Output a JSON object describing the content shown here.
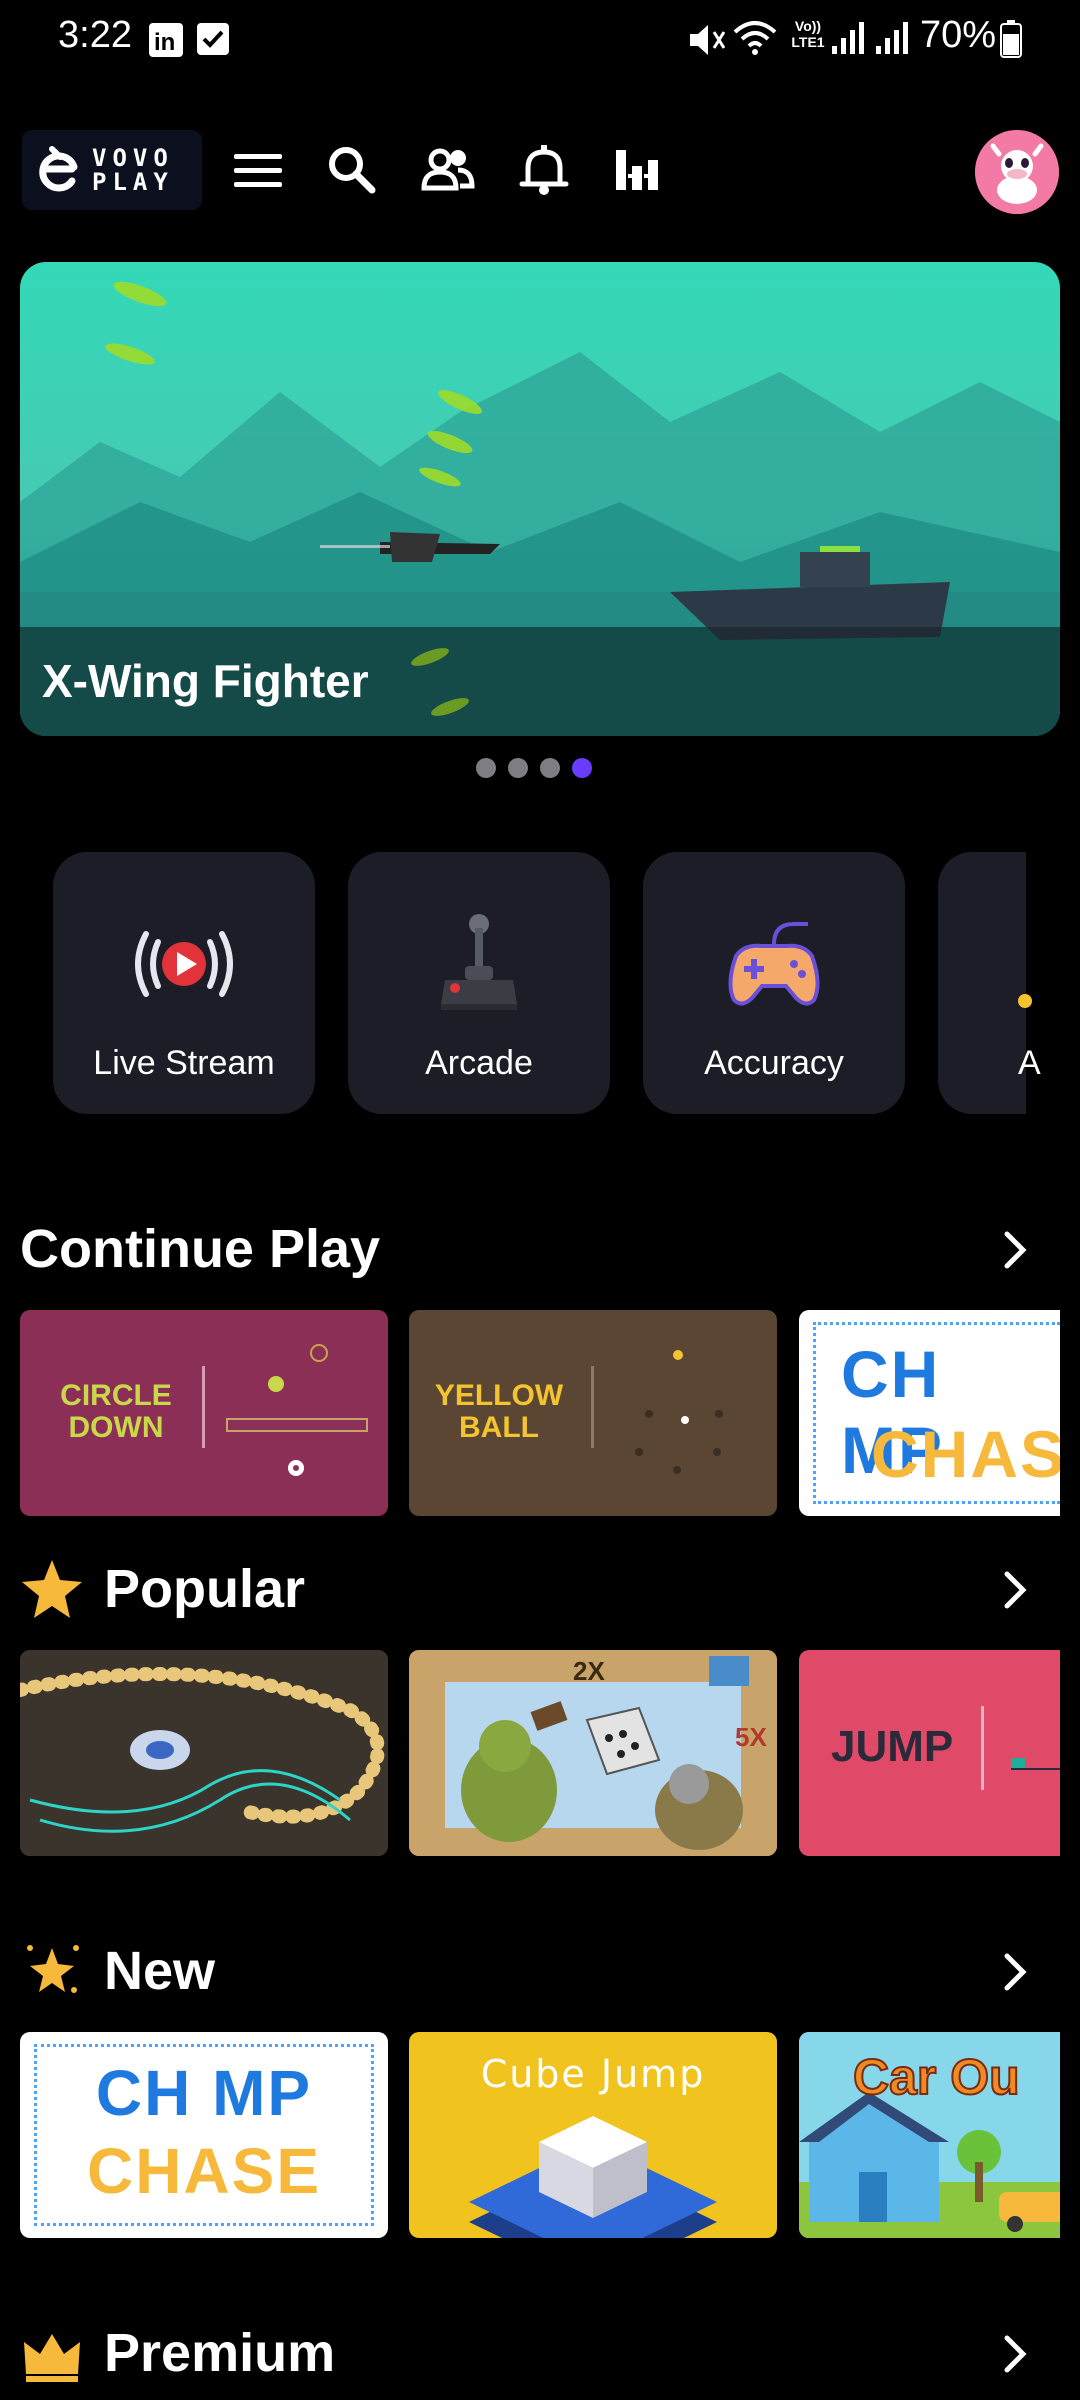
{
  "status_bar": {
    "time": "3:22",
    "battery": "70%",
    "network": "Vo)) LTE1"
  },
  "header": {
    "logo_text_1": "VOVO",
    "logo_text_2": "PLAY"
  },
  "banner": {
    "title": "X-Wing Fighter",
    "pager_count": 4,
    "pager_active": 4
  },
  "categories": [
    {
      "label": "Live Stream",
      "icon": "live-stream-icon"
    },
    {
      "label": "Arcade",
      "icon": "joystick-icon"
    },
    {
      "label": "Accuracy",
      "icon": "gamepad-icon"
    },
    {
      "label": "A",
      "icon": "partial-icon"
    }
  ],
  "sections": {
    "continue_play": {
      "title": "Continue Play",
      "cards": [
        {
          "line1": "CIRCLE",
          "line2": "DOWN"
        },
        {
          "line1": "YELLOW",
          "line2": "BALL"
        },
        {
          "line1": "CH MP",
          "line2": "CHAS"
        }
      ]
    },
    "popular": {
      "title": "Popular",
      "cards": [
        {
          "badge_1": "2X",
          "badge_2": "5X"
        },
        {
          "text": "JUMP"
        }
      ]
    },
    "new": {
      "title": "New",
      "cards": [
        {
          "line1": "CH MP",
          "line2": "CHASE"
        },
        {
          "line1": "Cube Jump"
        },
        {
          "line1": "Car Ou"
        }
      ]
    },
    "premium": {
      "title": "Premium"
    }
  }
}
